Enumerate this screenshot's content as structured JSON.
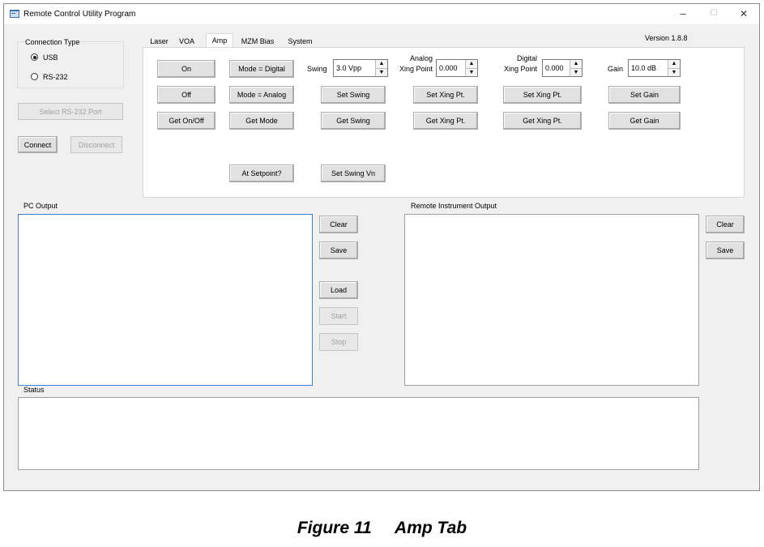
{
  "window": {
    "title": "Remote Control Utility Program",
    "minimize_glyph": "–",
    "maximize_glyph": "☐",
    "close_glyph": "✕",
    "icon": "app-icon"
  },
  "version": "Version 1.8.8",
  "connection": {
    "group_label": "Connection Type",
    "usb_label": "USB",
    "usb_selected": true,
    "rs232_label": "RS-232",
    "select_port_label": "Select RS-232 Port",
    "connect_label": "Connect",
    "disconnect_label": "Disconnect"
  },
  "tabs": [
    {
      "label": "Laser",
      "active": false
    },
    {
      "label": "VOA",
      "active": false
    },
    {
      "label": "Amp",
      "active": true
    },
    {
      "label": "MZM Bias",
      "active": false
    },
    {
      "label": "System",
      "active": false
    }
  ],
  "amp": {
    "on_label": "On",
    "off_label": "Off",
    "get_on_off_label": "Get On/Off",
    "mode_digital_label": "Mode = Digital",
    "mode_analog_label": "Mode = Analog",
    "get_mode_label": "Get Mode",
    "at_setpoint_label": "At Setpoint?",
    "swing_label": "Swing",
    "swing_value": "3.0 Vpp",
    "set_swing_label": "Set Swing",
    "get_swing_label": "Get Swing",
    "set_swing_vn_label": "Set Swing Vn",
    "analog_label_line1": "Analog",
    "analog_label_line2": "Xing Point",
    "analog_value": "0.000",
    "analog_set_label": "Set Xing Pt.",
    "analog_get_label": "Get Xing Pt.",
    "digital_label_line1": "Digital",
    "digital_label_line2": "Xing Point",
    "digital_value": "0.000",
    "digital_set_label": "Set Xing Pt.",
    "digital_get_label": "Get Xing Pt.",
    "gain_label": "Gain",
    "gain_value": "10.0 dB",
    "set_gain_label": "Set Gain",
    "get_gain_label": "Get Gain"
  },
  "pc_output": {
    "label": "PC Output",
    "clear_label": "Clear",
    "save_label": "Save",
    "load_label": "Load",
    "start_label": "Start",
    "stop_label": "Stop"
  },
  "remote_output": {
    "label": "Remote Instrument Output",
    "clear_label": "Clear",
    "save_label": "Save"
  },
  "status": {
    "label": "Status"
  },
  "caption": "Figure 11     Amp Tab"
}
